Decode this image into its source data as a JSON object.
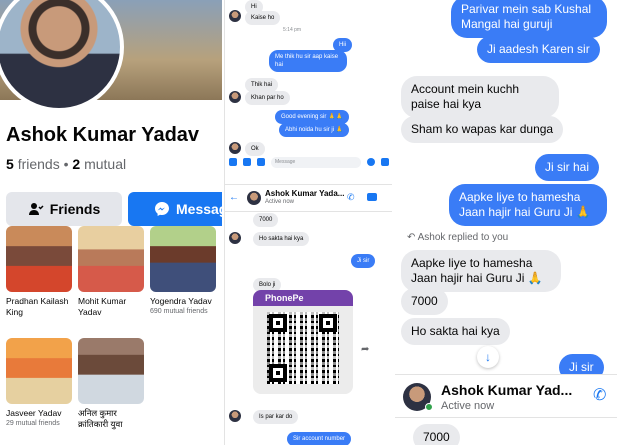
{
  "profile": {
    "name": "Ashok Kumar Yadav",
    "friends_count": "5",
    "friends_label": "friends",
    "separator": "•",
    "mutual_count": "2",
    "mutual_label": "mutual",
    "friends_button": "Friends",
    "message_button": "Message",
    "friend_tiles": [
      {
        "name": "Pradhan Kailash King",
        "mutual": ""
      },
      {
        "name": "Mohit Kumar Yadav",
        "mutual": ""
      },
      {
        "name": "Yogendra Yadav",
        "mutual": "690 mutual friends"
      },
      {
        "name": "Jasveer Yadav",
        "mutual": "29 mutual friends"
      },
      {
        "name": "अनिल कुमार क्रांतिकारी युवा",
        "mutual": ""
      }
    ]
  },
  "chat_small": {
    "messages_top": [
      {
        "text": "Hi",
        "dir": "in"
      },
      {
        "text": "Kaise ho",
        "dir": "in"
      },
      {
        "text": "5:14 pm",
        "dir": "ts"
      },
      {
        "text": "Hii",
        "dir": "out"
      },
      {
        "text": "Me thik hu sir aap kaise hai",
        "dir": "out"
      },
      {
        "text": "Thik hai",
        "dir": "in"
      },
      {
        "text": "Khan par ho",
        "dir": "in"
      },
      {
        "text": "Good evening sir 🙏🙏",
        "dir": "out"
      },
      {
        "text": "Abhi noida hu sir ji 🙏",
        "dir": "out"
      },
      {
        "text": "Ok",
        "dir": "in"
      }
    ],
    "input_placeholder": "Message",
    "header_name": "Ashok Kumar Yada...",
    "header_status": "Active now",
    "messages_bottom": [
      {
        "text": "7000",
        "dir": "in"
      },
      {
        "text": "Ho sakta hai kya",
        "dir": "in"
      },
      {
        "text": "Ji sir",
        "dir": "out"
      },
      {
        "text": "Bolo ji",
        "dir": "in"
      },
      {
        "text": "Is par kar do",
        "dir": "in"
      },
      {
        "text": "Sir account number",
        "dir": "out"
      }
    ],
    "qr_brand": "PhonePe"
  },
  "chat_large": {
    "messages": [
      {
        "text": "Parivar mein sab Kushal Mangal hai guruji",
        "dir": "out"
      },
      {
        "text": "Ji aadesh Karen sir",
        "dir": "out"
      },
      {
        "text": "Account mein kuchh paise hai kya",
        "dir": "in"
      },
      {
        "text": "Sham ko wapas kar dunga",
        "dir": "in"
      },
      {
        "text": "Ji sir hai",
        "dir": "out"
      },
      {
        "text": "Aapke liye to hamesha Jaan hajir hai Guru Ji 🙏",
        "dir": "out"
      },
      {
        "text": "Aapke liye to hamesha Jaan hajir hai Guru Ji 🙏",
        "dir": "in"
      },
      {
        "text": "7000",
        "dir": "in"
      },
      {
        "text": "Ho sakta hai kya",
        "dir": "in"
      },
      {
        "text": "Ji sir",
        "dir": "out"
      },
      {
        "text": "7000",
        "dir": "in"
      }
    ],
    "reply_note": "Ashok replied to you",
    "header_name": "Ashok Kumar Yad...",
    "header_status": "Active now"
  },
  "colors": {
    "messenger_blue": "#3a7cf6",
    "facebook_blue": "#1877f2",
    "bubble_gray": "#e9eaed"
  }
}
